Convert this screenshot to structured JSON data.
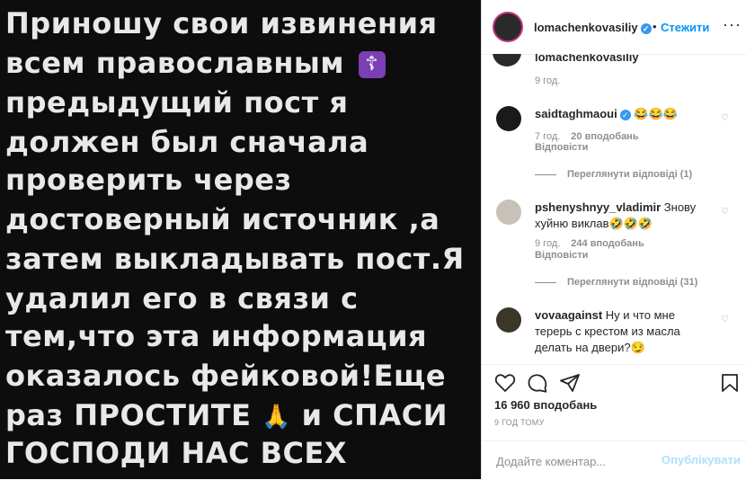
{
  "post_image": {
    "lines": [
      "Приношу свои извинения",
      "всем православным",
      "предыдущий пост я",
      "должен был сначала",
      "проверить через",
      "достоверный источник ,а",
      "затем выкладывать пост.Я",
      "удалил его в связи с",
      "тем,что эта информация",
      "оказалось фейковой!Еще",
      "раз ПРОСТИТЕ",
      "и СПАСИ",
      "ГОСПОДИ НАС ВСЕХ"
    ],
    "cross_emoji": "☦",
    "hands_emoji": "🙏"
  },
  "header": {
    "username": "lomachenkovasiliy",
    "verified_icon": "✓",
    "dot": "•",
    "follow_label": "Стежити",
    "more_icon": "···"
  },
  "caption": {
    "username": "lomachenkovasiliy",
    "time": "9 год."
  },
  "comments": [
    {
      "username": "saidtaghmaoui",
      "verified": "✓",
      "text": "😂😂😂",
      "time": "7 год.",
      "likes": "20 вподобань",
      "reply": "Відповісти",
      "view_replies": "Переглянути відповіді (1)"
    },
    {
      "username": "pshenyshnyy_vladimir",
      "text": "Знову хуйню виклав🤣🤣🤣",
      "time": "9 год.",
      "likes": "244 вподобань",
      "reply": "Відповісти",
      "view_replies": "Переглянути відповіді (31)"
    },
    {
      "username": "vovaagainst",
      "text": "Ну и что мне терерь с крестом из масла делать на двери?😏"
    }
  ],
  "heart_icon": "♡",
  "likes_count": "16 960 вподобань",
  "post_time": "9 ГОД ТОМУ",
  "add_comment": {
    "placeholder": "Додайте коментар...",
    "publish_label": "Опублікувати"
  }
}
